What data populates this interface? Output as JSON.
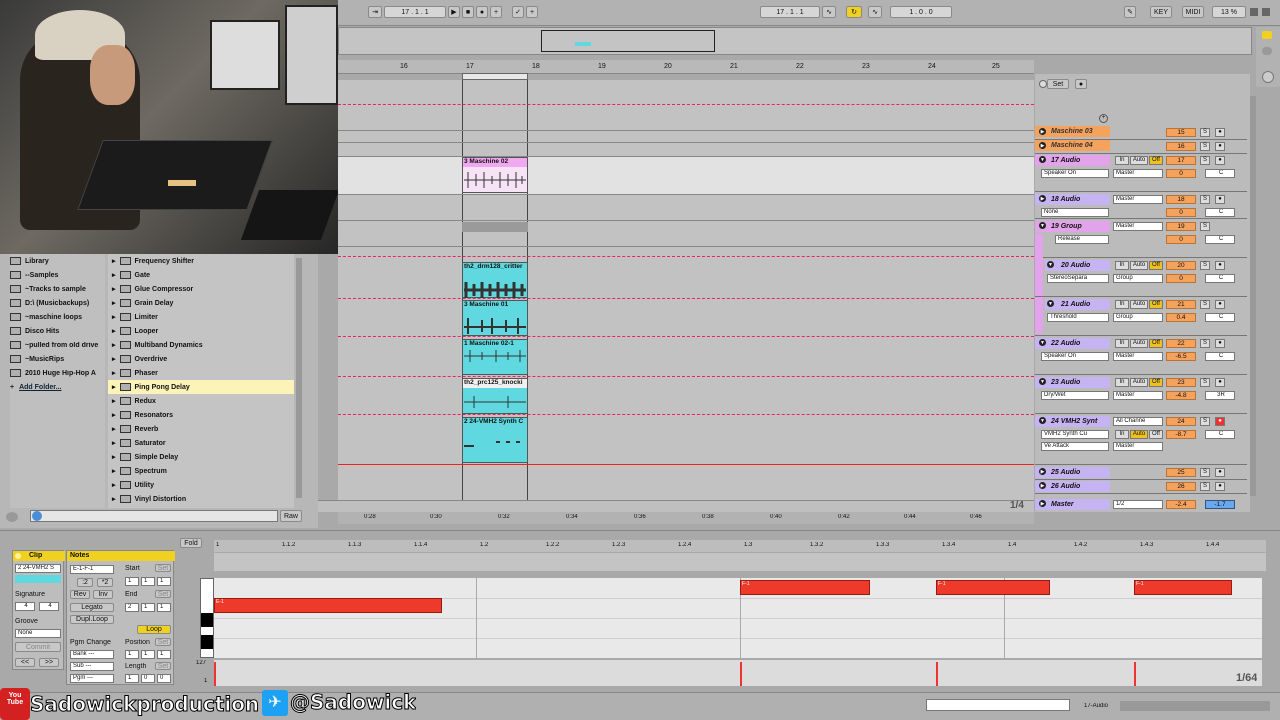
{
  "transport": {
    "arrangement_position": "17 .  1 .  1",
    "loop_start": "17 .  1 .  1",
    "loop_length": "1 .  0 .  0",
    "key_label": "KEY",
    "midi_label": "MIDI",
    "cpu_load": "13 %"
  },
  "arrangement": {
    "bar_ruler": [
      "16",
      "17",
      "18",
      "19",
      "20",
      "21",
      "22",
      "23",
      "24",
      "25"
    ],
    "time_ruler": [
      "0:28",
      "0:30",
      "0:32",
      "0:34",
      "0:36",
      "0:38",
      "0:40",
      "0:42",
      "0:44",
      "0:46"
    ],
    "zoom_ratio": "1/4",
    "set_label": "Set",
    "clips": [
      {
        "name": "3 Maschine 02",
        "color": "#f0a8f0"
      },
      {
        "name": "th2_drm128_critter",
        "color": "#5fd8e0"
      },
      {
        "name": "3 Maschine 01",
        "color": "#5fd8e0"
      },
      {
        "name": "1 Maschine 02-1",
        "color": "#5fd8e0"
      },
      {
        "name": "th2_prc125_knocki",
        "color": "#5fd8e0"
      },
      {
        "name": "2 24-VMH2 Synth C",
        "color": "#5fd8e0"
      }
    ]
  },
  "tracks": [
    {
      "name": "Maschine 03",
      "num": "15",
      "color": "#f5a25d",
      "s": "S"
    },
    {
      "name": "Maschine 04",
      "num": "16",
      "color": "#f5a25d",
      "s": "S"
    },
    {
      "name": "17 Audio",
      "num": "17",
      "color": "#e3a3ea",
      "input": "Speaker On",
      "out": "Master",
      "vol": "0",
      "pan": "C",
      "s": "S"
    },
    {
      "name": "18 Audio",
      "num": "18",
      "color": "#c6b3f2",
      "input": "None",
      "out": "Master",
      "vol": "0",
      "pan": "C",
      "s": "S"
    },
    {
      "name": "19 Group",
      "num": "19",
      "color": "#e3a3ea",
      "input": "Release",
      "out": "Master",
      "vol": "0",
      "pan": "C",
      "s": "S"
    },
    {
      "name": "20 Audio",
      "num": "20",
      "color": "#c6b3f2",
      "input": "StereoSepara",
      "out": "Group",
      "vol": "0",
      "pan": "C",
      "s": "S"
    },
    {
      "name": "21 Audio",
      "num": "21",
      "color": "#c6b3f2",
      "input": "Threshold",
      "out": "Group",
      "vol": "0.4",
      "pan": "C",
      "s": "S"
    },
    {
      "name": "22 Audio",
      "num": "22",
      "color": "#c6b3f2",
      "input": "Speaker On",
      "out": "Master",
      "vol": "-6.5",
      "pan": "C",
      "s": "S"
    },
    {
      "name": "23 Audio",
      "num": "23",
      "color": "#c6b3f2",
      "input": "Dry/Wet",
      "out": "Master",
      "vol": "-4.8",
      "pan": "3R",
      "s": "S"
    },
    {
      "name": "24 VMH2 Synt",
      "num": "24",
      "color": "#c6b3f2",
      "input": "VMH2 Synth Cu",
      "input2": "Ve Attack",
      "out": "All Channe",
      "out2": "Master",
      "vol": "-8.7",
      "pan": "C",
      "s": "S"
    },
    {
      "name": "25 Audio",
      "num": "25",
      "color": "#c6b3f2",
      "s": "S"
    },
    {
      "name": "26 Audio",
      "num": "26",
      "color": "#c6b3f2",
      "s": "S"
    },
    {
      "name": "Master",
      "num": "",
      "color": "#c6b3f2",
      "out": "1/2",
      "vol": "-2.4",
      "pan": "-1.7"
    }
  ],
  "track_buttons": {
    "in": "In",
    "auto": "Auto",
    "off": "Off"
  },
  "browser": {
    "places": [
      "Library",
      "--Samples",
      "~Tracks to sample",
      "D:\\ (Musicbackups)",
      "~maschine loops",
      "Disco Hits",
      "~pulled from old drive",
      "~MusicRips",
      "2010 Huge Hip-Hop A",
      "Add Folder..."
    ],
    "effects": [
      "Frequency Shifter",
      "Gate",
      "Glue Compressor",
      "Grain Delay",
      "Limiter",
      "Looper",
      "Multiband Dynamics",
      "Overdrive",
      "Phaser",
      "Ping Pong Delay",
      "Redux",
      "Resonators",
      "Reverb",
      "Saturator",
      "Simple Delay",
      "Spectrum",
      "Utility",
      "Vinyl Distortion"
    ],
    "selected": "Ping Pong Delay",
    "raw_label": "Raw"
  },
  "clip_view": {
    "clip_title": "Clip",
    "clip_name": "2 24-VMH2 S",
    "signature_label": "Signature",
    "sig_num": "4",
    "sig_den": "4",
    "groove_label": "Groove",
    "groove_value": "None",
    "commit_label": "Commit",
    "notes_title": "Notes",
    "note_range": "E-1-F-1",
    "half_label": ":2",
    "double_label": "*2",
    "rev_label": "Rev",
    "inv_label": "Inv",
    "legato_label": "Legato",
    "dupl_loop_label": "Dupl.Loop",
    "pgm_change_label": "Pgm Change",
    "bank_label": "Bank ---",
    "sub_label": "Sub ---",
    "pgm_label": "Pgm ---",
    "start_label": "Start",
    "end_label": "End",
    "loop_label": "Loop",
    "position_label": "Position",
    "length_label": "Length",
    "set_btn": "Set",
    "start_vals": [
      "1",
      "1",
      "1"
    ],
    "end_vals": [
      "2",
      "1",
      "1"
    ],
    "position_vals": [
      "1",
      "1",
      "1"
    ],
    "length_vals": [
      "1",
      "0",
      "0"
    ],
    "fold_label": "Fold",
    "ruler": [
      "1",
      "1.1.2",
      "1.1.3",
      "1.1.4",
      "1.2",
      "1.2.2",
      "1.2.3",
      "1.2.4",
      "1.3",
      "1.3.2",
      "1.3.3",
      "1.3.4",
      "1.4",
      "1.4.2",
      "1.4.3",
      "1.4.4"
    ],
    "velocity_max": "127",
    "velocity_min": "1",
    "grid": "1/64",
    "note_label": "F-1",
    "note_label_low": "E-1"
  },
  "overlay": {
    "youtube_icon_text": "You Tube",
    "channel": "Sadowickproduction",
    "twitter": "@Sadowick"
  },
  "status": {
    "track_label": "17-Audio"
  }
}
